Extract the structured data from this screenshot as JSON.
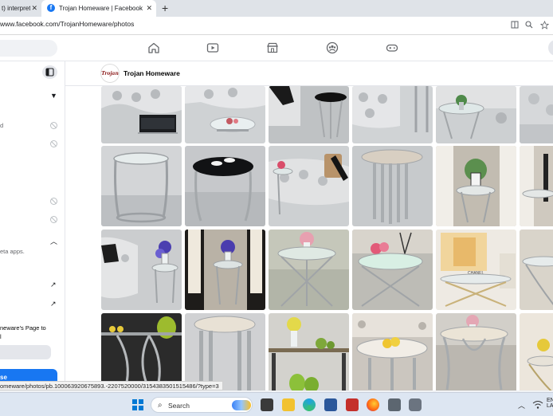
{
  "browser": {
    "tabs": [
      {
        "label": "t) interpret",
        "active": false
      },
      {
        "label": "Trojan Homeware | Facebook",
        "active": true
      }
    ],
    "close_glyph": "✕",
    "new_tab_glyph": "+",
    "url": "www.facebook.com/TrojanHomeware/photos",
    "addr_icons": [
      "reading-mode-icon",
      "zoom-icon",
      "favorite-star-icon"
    ]
  },
  "fb_nav": {
    "icons": [
      "home-icon",
      "watch-icon",
      "marketplace-icon",
      "groups-icon",
      "gaming-icon"
    ]
  },
  "sidebar": {
    "texts": [
      {
        "id": "d",
        "text": "d"
      },
      {
        "id": "meta-apps",
        "text": "eta apps."
      },
      {
        "id": "page-cta",
        "line1": "neware's Page to",
        "line2": "l"
      }
    ],
    "blue_button_label": "se"
  },
  "page": {
    "avatar_text": "Trojan",
    "name": "Trojan Homeware"
  },
  "photos": {
    "count_visible": 24,
    "description": "grid of furniture photos"
  },
  "status_bar": {
    "text": "omeware/photos/pb.100063920675893.-2207520000/3154383501515486/?type=3"
  },
  "taskbar": {
    "search_label": "Search",
    "tray_lang": "EN",
    "tray_lang2": "LA",
    "apps": [
      "file-explorer-icon",
      "edge-icon",
      "word-icon",
      "photos-icon",
      "firefox-icon",
      "calculator-icon",
      "camera-icon"
    ]
  }
}
